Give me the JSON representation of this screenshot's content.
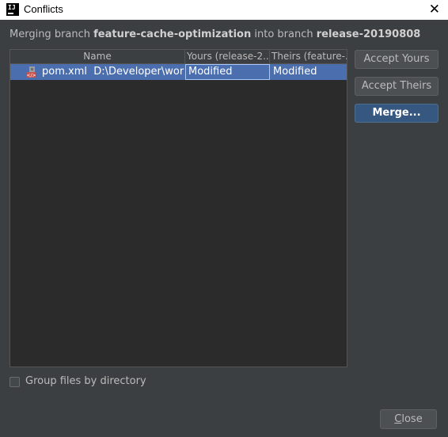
{
  "window": {
    "title": "Conflicts",
    "icon": "intellij-idea-icon",
    "icon_text": "IJ"
  },
  "message": {
    "prefix": "Merging branch ",
    "source_branch": "feature-cache-optimization",
    "middle": " into branch ",
    "target_branch": "release-20190808"
  },
  "table": {
    "columns": {
      "name": "Name",
      "yours": "Yours (release-2...",
      "theirs": "Theirs (feature-..."
    },
    "rows": [
      {
        "file_name": "pom.xml",
        "path": "D:\\Developer\\worksp",
        "yours": "Modified",
        "theirs": "Modified",
        "icon": "maven-file-icon"
      }
    ]
  },
  "buttons": {
    "accept_yours": "Accept Yours",
    "accept_theirs": "Accept Theirs",
    "merge": "Merge...",
    "close_mnemonic": "C",
    "close_rest": "lose"
  },
  "options": {
    "group_by_directory": "Group files by directory",
    "group_by_directory_checked": false
  },
  "colors": {
    "background": "#3c3f41",
    "table_background": "#2b2b2b",
    "selection": "#4b6eaf",
    "primary_button": "#365880"
  }
}
